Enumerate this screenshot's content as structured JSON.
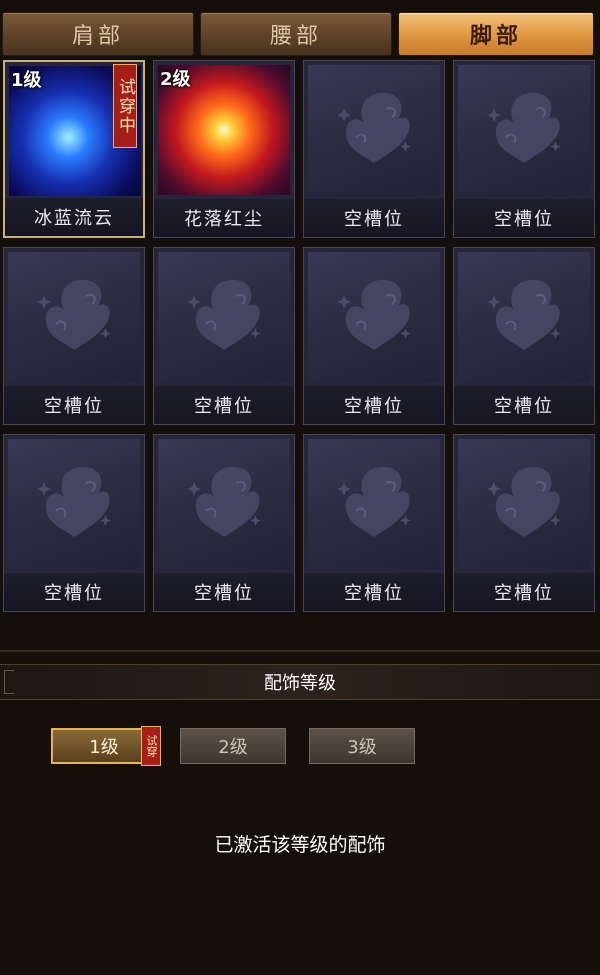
{
  "tabs": [
    {
      "label": "肩部",
      "active": false
    },
    {
      "label": "腰部",
      "active": false
    },
    {
      "label": "脚部",
      "active": true
    }
  ],
  "slots": [
    {
      "name": "冰蓝流云",
      "level": "1级",
      "trial": "试穿中",
      "style": "blue",
      "selected": true
    },
    {
      "name": "花落红尘",
      "level": "2级",
      "trial": "",
      "style": "red",
      "selected": false
    },
    {
      "name": "空槽位"
    },
    {
      "name": "空槽位"
    },
    {
      "name": "空槽位"
    },
    {
      "name": "空槽位"
    },
    {
      "name": "空槽位"
    },
    {
      "name": "空槽位"
    },
    {
      "name": "空槽位"
    },
    {
      "name": "空槽位"
    },
    {
      "name": "空槽位"
    },
    {
      "name": "空槽位"
    }
  ],
  "level_section": {
    "title": "配饰等级",
    "levels": [
      {
        "label": "1级",
        "active": true,
        "badge": "试穿"
      },
      {
        "label": "2级",
        "active": false
      },
      {
        "label": "3级",
        "active": false
      }
    ],
    "status": "已激活该等级的配饰"
  }
}
